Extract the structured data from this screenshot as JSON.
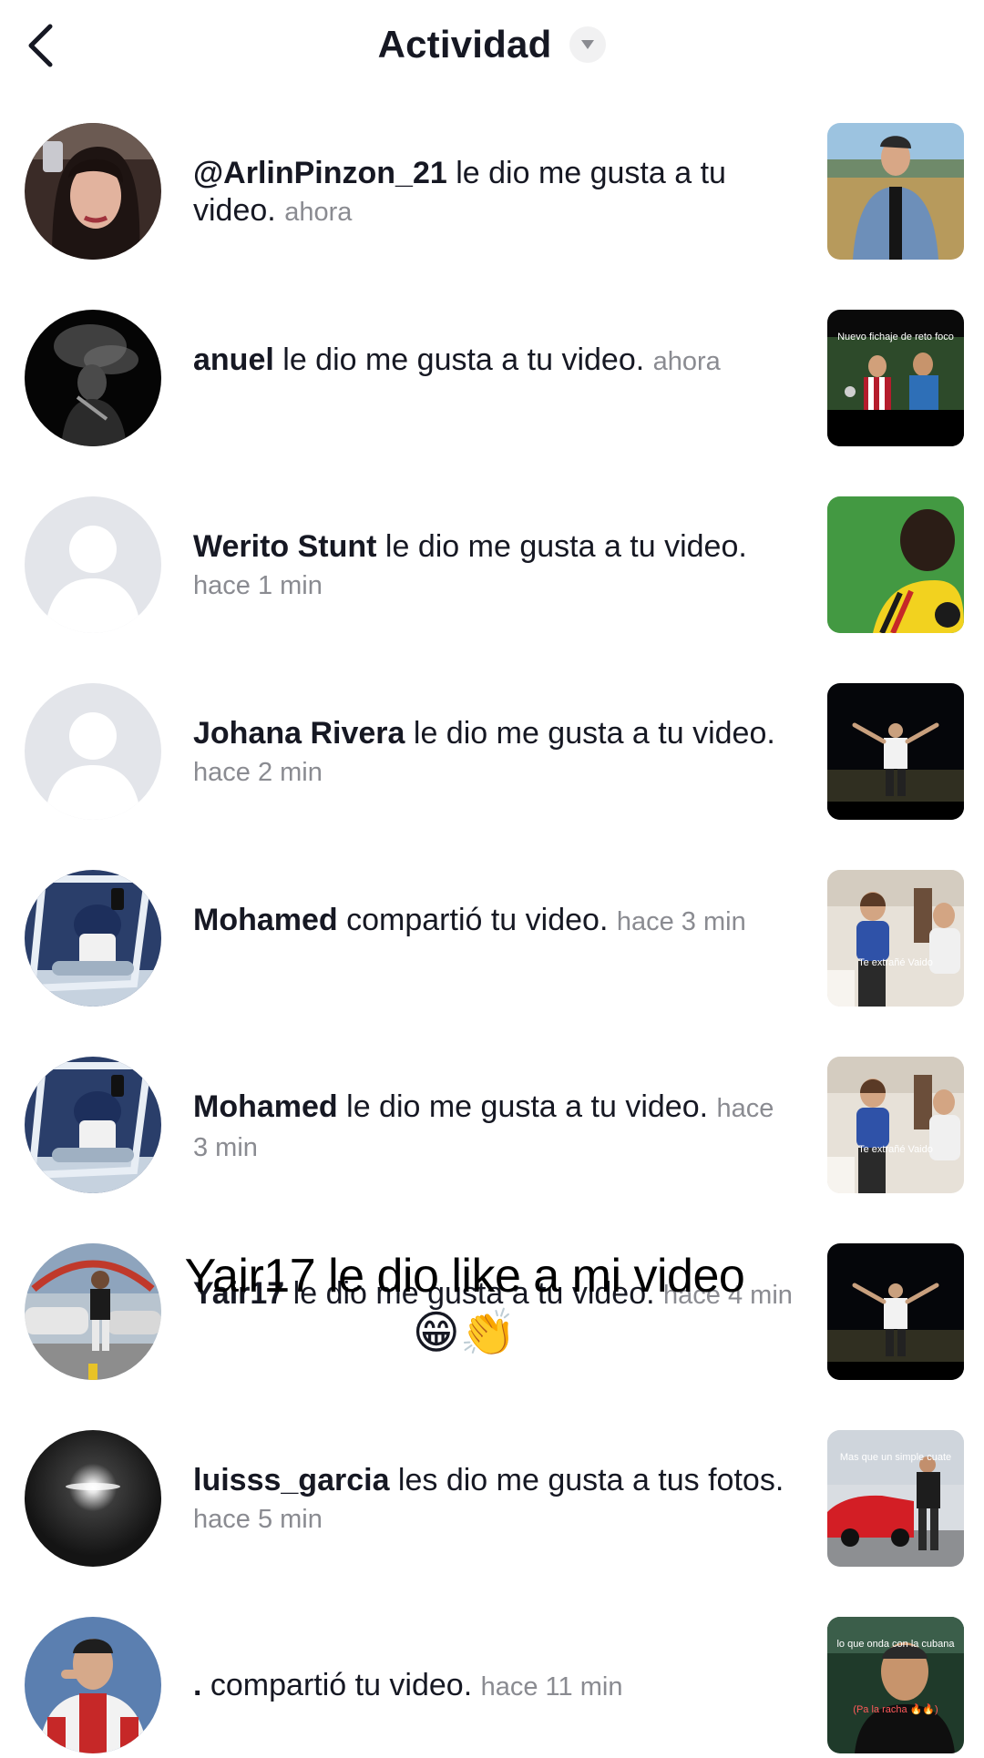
{
  "header": {
    "title": "Actividad"
  },
  "colors": {
    "text": "#161823",
    "muted": "#8a8b91",
    "default_avatar_bg": "#e3e5ea",
    "default_avatar_fg": "#ffffff"
  },
  "activity": [
    {
      "username": "@ArlinPinzon_21",
      "action": " le dio me gusta a tu video.",
      "time": "ahora",
      "avatar": "photo-woman",
      "thumbnail": "man-field"
    },
    {
      "username": "anuel",
      "action": " le dio me gusta a tu video.",
      "time": "ahora",
      "avatar": "photo-smoke-bw",
      "thumbnail": "soccer-players",
      "thumbnail_caption": "Nuevo fichaje de reto foco"
    },
    {
      "username": "Werito Stunt",
      "action": " le dio me gusta a tu video.",
      "time": "hace 1 min",
      "avatar": "default-avatar",
      "thumbnail": "player-green-field"
    },
    {
      "username": "Johana Rivera",
      "action": " le dio me gusta a tu video.",
      "time": "hace 2 min",
      "avatar": "default-avatar",
      "thumbnail": "man-night-arms"
    },
    {
      "username": "Mohamed",
      "action": " compartió tu video.",
      "time": "hace 3 min",
      "avatar": "photo-car-selfie",
      "thumbnail": "people-room",
      "thumbnail_caption": "Te extrañé Vaido"
    },
    {
      "username": "Mohamed",
      "action": " le dio me gusta a tu video.",
      "time": "hace 3 min",
      "avatar": "photo-car-selfie",
      "thumbnail": "people-room",
      "thumbnail_caption": "Te extrañé Vaido"
    },
    {
      "username": "Yair17",
      "action": " le dio me gusta a tu video.",
      "time": "hace 4 min",
      "avatar": "photo-man-cars",
      "thumbnail": "man-night-arms"
    },
    {
      "username": "luisss_garcia",
      "action": " les dio me gusta a tus fotos.",
      "time": "hace 5 min",
      "avatar": "photo-dark-flash",
      "thumbnail": "man-red-car",
      "thumbnail_caption": "Mas que un simple cuate"
    },
    {
      "username": ".",
      "action": " compartió tu video.",
      "time": "hace 11 min",
      "avatar": "photo-jersey",
      "thumbnail": "man-stadium",
      "thumbnail_caption": "lo que onda con la cubana",
      "thumbnail_caption2": "(Pa la racha 🔥🔥)"
    }
  ],
  "overlay": {
    "line1": "Yair17 le dio like a mi video",
    "emoji": "😁👏"
  }
}
